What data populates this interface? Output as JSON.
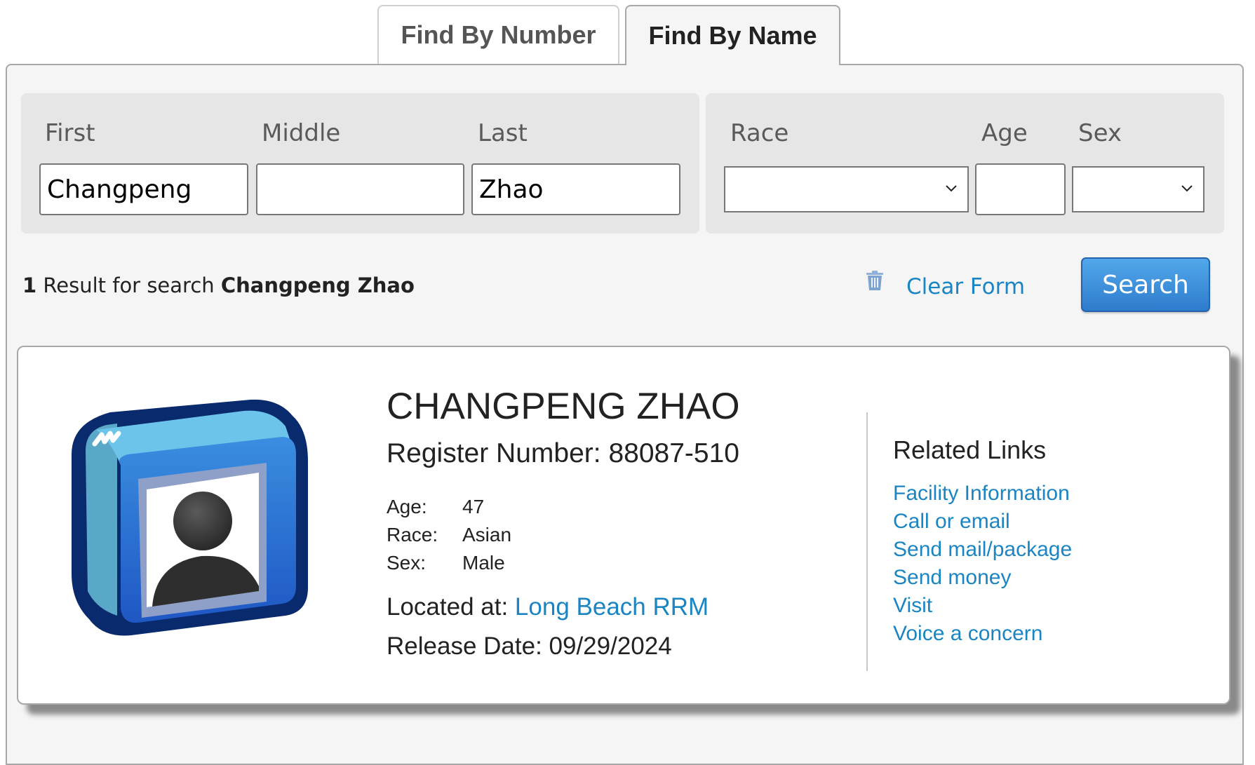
{
  "tabs": [
    {
      "label": "Find By Number",
      "active": false
    },
    {
      "label": "Find By Name",
      "active": true
    }
  ],
  "form": {
    "first": {
      "label": "First",
      "value": "Changpeng"
    },
    "middle": {
      "label": "Middle",
      "value": ""
    },
    "last": {
      "label": "Last",
      "value": "Zhao"
    },
    "race": {
      "label": "Race",
      "value": ""
    },
    "age": {
      "label": "Age",
      "value": ""
    },
    "sex": {
      "label": "Sex",
      "value": ""
    }
  },
  "results": {
    "count": "1",
    "text": " Result for search ",
    "query": "Changpeng Zhao"
  },
  "actions": {
    "clear_label": "Clear Form",
    "clear_icon": "trash-icon",
    "search_label": "Search"
  },
  "colors": {
    "link": "#1a85c2",
    "search_button": "#3a8fdc",
    "panel_bg": "#f5f5f5",
    "field_group_bg": "#e6e6e6"
  },
  "inmate": {
    "avatar_icon": "person-photo-icon",
    "name": "CHANGPENG ZHAO",
    "register_label": "Register Number: ",
    "register_number": "88087-510",
    "details": [
      {
        "label": "Age:",
        "value": "47"
      },
      {
        "label": "Race:",
        "value": "Asian"
      },
      {
        "label": "Sex:",
        "value": "Male"
      }
    ],
    "located_label": "Located at: ",
    "location": "Long Beach RRM",
    "release_label": "Release Date: ",
    "release_date": "09/29/2024"
  },
  "related_links": {
    "title": "Related Links",
    "items": [
      "Facility Information",
      "Call or email",
      "Send mail/package",
      "Send money",
      "Visit",
      "Voice a concern"
    ]
  }
}
